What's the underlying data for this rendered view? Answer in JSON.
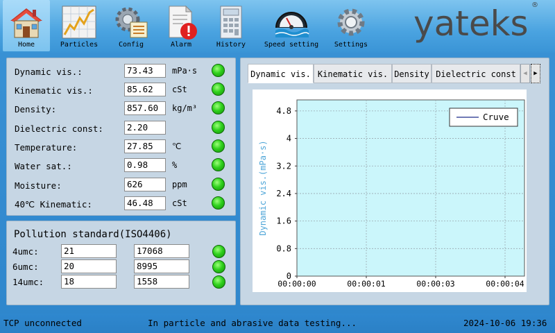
{
  "nav": {
    "items": [
      {
        "label": "Home",
        "icon": "home-icon"
      },
      {
        "label": "Particles",
        "icon": "particles-chart-icon"
      },
      {
        "label": "Config",
        "icon": "config-gear-icon"
      },
      {
        "label": "Alarm",
        "icon": "alarm-document-icon"
      },
      {
        "label": "History",
        "icon": "history-calculator-icon"
      },
      {
        "label": "Speed setting",
        "icon": "speed-gauge-icon"
      },
      {
        "label": "Settings",
        "icon": "settings-gear-icon"
      }
    ],
    "active": "Home"
  },
  "brand": {
    "logo": "yateks",
    "registered": "®"
  },
  "parameters": [
    {
      "label": "Dynamic vis.:",
      "value": "73.43",
      "unit": "mPa·s"
    },
    {
      "label": "Kinematic vis.:",
      "value": "85.62",
      "unit": "cSt"
    },
    {
      "label": "Density:",
      "value": "857.60",
      "unit": "kg/m³"
    },
    {
      "label": "Dielectric const:",
      "value": "2.20",
      "unit": ""
    },
    {
      "label": "Temperature:",
      "value": "27.85",
      "unit": "℃"
    },
    {
      "label": "Water sat.:",
      "value": "0.98",
      "unit": "%"
    },
    {
      "label": "Moisture:",
      "value": "626",
      "unit": "ppm"
    },
    {
      "label": "40℃ Kinematic:",
      "value": "46.48",
      "unit": "cSt"
    }
  ],
  "pollution": {
    "title": "Pollution standard(ISO4406)",
    "rows": [
      {
        "label": "4umc:",
        "code": "21",
        "count": "17068"
      },
      {
        "label": "6umc:",
        "code": "20",
        "count": "8995"
      },
      {
        "label": "14umc:",
        "code": "18",
        "count": "1558"
      }
    ]
  },
  "chart_tabs": {
    "tabs": [
      "Dynamic vis.",
      "Kinematic vis.",
      "Density",
      "Dielectric const"
    ],
    "active": "Dynamic vis.",
    "left_arrow": "◀",
    "right_arrow": "▶"
  },
  "chart_data": {
    "type": "line",
    "title": "",
    "xlabel": "",
    "ylabel": "Dynamic vis.(mPa·s)",
    "ylim": [
      0,
      5.12
    ],
    "y_ticks": [
      0,
      0.8,
      1.6,
      2.4,
      3.2,
      4,
      4.8
    ],
    "y_tick_labels": [
      "0",
      "0.8",
      "1.6",
      "2.4",
      "3.2",
      "4",
      "4.8"
    ],
    "x_tick_labels": [
      "00:00:00",
      "00:00:01",
      "00:00:03",
      "00:00:04"
    ],
    "grid": true,
    "legend_position": "top-right",
    "series": [
      {
        "name": "Cruve",
        "x": [],
        "values": []
      }
    ],
    "colors": {
      "background": "#cbf6fb",
      "line": "#1a2a8a",
      "grid": "#9aa8b0",
      "axis_label": "#4fa6d8"
    }
  },
  "status": {
    "connection": "TCP unconnected",
    "message": "In particle and abrasive data testing...",
    "datetime": "2024-10-06 19:36"
  },
  "colors": {
    "led_ok": "#2fd11d",
    "panel": "#c6d6e4",
    "background": "#2e86cc"
  }
}
